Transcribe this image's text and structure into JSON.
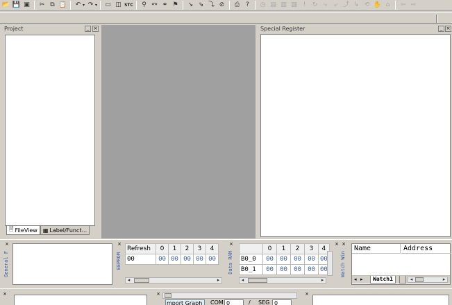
{
  "toolbar": {
    "icons": [
      "open-icon",
      "save-icon",
      "save-all-icon",
      "cut-icon",
      "copy-icon",
      "paste-icon",
      "undo-icon",
      "redo-icon",
      "window-icon",
      "window-find-icon",
      "stc-icon",
      "binoculars-icon",
      "find-next-icon",
      "find-prev-icon",
      "bookmark-icon",
      "compile-icon",
      "build-icon",
      "rebuild-icon",
      "stop-build-icon",
      "print-icon",
      "help-icon"
    ],
    "stc_label": "STC"
  },
  "project_pane": {
    "title": "Project",
    "tabs": [
      {
        "label": "FileView",
        "icon": "file-icon"
      },
      {
        "label": "Label/Funct...",
        "icon": "label-icon"
      }
    ]
  },
  "special_register_pane": {
    "title": "Special Register"
  },
  "general_pane": {
    "side_label": "General F"
  },
  "eeprom_pane": {
    "side_label": "EEPROM",
    "refresh_label": "Refresh",
    "columns": [
      "0",
      "1",
      "2",
      "3",
      "4"
    ],
    "rows": [
      {
        "label": "00",
        "values": [
          "00",
          "00",
          "00",
          "00",
          "00"
        ]
      }
    ]
  },
  "data_ram_pane": {
    "side_label": "Data RAM",
    "columns": [
      "0",
      "1",
      "2",
      "3",
      "4"
    ],
    "rows": [
      {
        "label": "B0_0",
        "values": [
          "00",
          "00",
          "00",
          "00",
          "00"
        ]
      },
      {
        "label": "B0_1",
        "values": [
          "00",
          "00",
          "00",
          "00",
          "00"
        ]
      }
    ]
  },
  "watch_pane": {
    "side_label": "Watch Win",
    "columns": [
      "Name",
      "Address"
    ],
    "tab_label": "Watch1"
  },
  "bottom_bar": {
    "import_button": "mport Graph",
    "com_label": "COM",
    "com_value": "0",
    "slash": "/",
    "seg_label": "SEG",
    "seg_value": "0"
  },
  "colors": {
    "window_bg": "#d4d0c8",
    "mdi_bg": "#a0a0a0",
    "value_blue": "#3a5ea8"
  }
}
